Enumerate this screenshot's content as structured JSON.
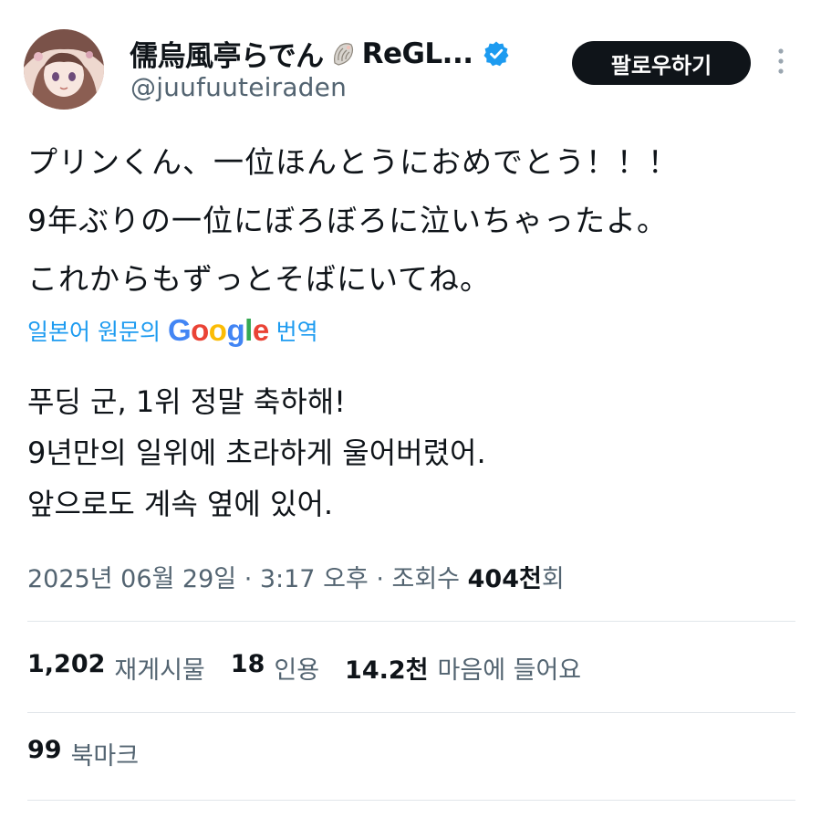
{
  "header": {
    "display_name": "儒烏風亭らでん",
    "display_name_suffix": "ReGL...",
    "handle": "@juufuuteiraden",
    "follow_label": "팔로우하기"
  },
  "tweet": {
    "lines": [
      "プリンくん、一位ほんとうにおめでとう！！！",
      "9年ぶりの一位にぼろぼろに泣いちゃったよ。",
      "これからもずっとそばにいてね。"
    ]
  },
  "translation": {
    "prefix": "일본어 원문의",
    "suffix": "번역",
    "google": [
      "G",
      "o",
      "o",
      "g",
      "l",
      "e"
    ],
    "translated_lines": [
      "푸딩 군, 1위 정말 축하해!",
      "9년만의 일위에 초라하게 울어버렸어.",
      "앞으로도 계속 옆에 있어."
    ]
  },
  "meta": {
    "timestamp": "2025년 06월 29일 · 3:17 오후 · 조회수",
    "views": "404천",
    "views_suffix": "회"
  },
  "stats": {
    "reposts_count": "1,202",
    "reposts_label": "재게시물",
    "quotes_count": "18",
    "quotes_label": "인용",
    "likes_count": "14.2천",
    "likes_label": "마음에 들어요",
    "bookmarks_count": "99",
    "bookmarks_label": "북마크"
  },
  "colors": {
    "accent": "#1d9bf0",
    "text": "#0f1419",
    "muted": "#536471",
    "divider": "#e1e6ea"
  },
  "icons": {
    "avatar": "avatar-illustration",
    "shell": "conch-shell-icon",
    "verified": "verified-badge-icon",
    "more": "more-vertical-icon"
  }
}
